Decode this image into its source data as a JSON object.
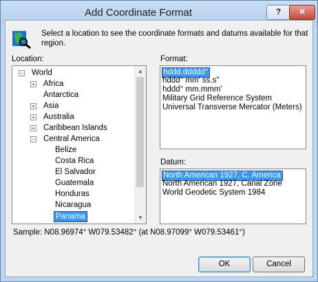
{
  "title": "Add Coordinate Format",
  "titlebar": {
    "help": "?",
    "close": "✕"
  },
  "intro_text": "Select a location to see the coordinate formats and datums available for that region.",
  "location_label": "Location:",
  "format_label": "Format:",
  "datum_label": "Datum:",
  "tree": [
    {
      "label": "World",
      "depth": 0,
      "expander": "−"
    },
    {
      "label": "Africa",
      "depth": 1,
      "expander": "+"
    },
    {
      "label": "Antarctica",
      "depth": 1,
      "expander": ""
    },
    {
      "label": "Asia",
      "depth": 1,
      "expander": "+"
    },
    {
      "label": "Australia",
      "depth": 1,
      "expander": "+"
    },
    {
      "label": "Caribbean Islands",
      "depth": 1,
      "expander": "+"
    },
    {
      "label": "Central America",
      "depth": 1,
      "expander": "−"
    },
    {
      "label": "Belize",
      "depth": 2,
      "expander": ""
    },
    {
      "label": "Costa Rica",
      "depth": 2,
      "expander": ""
    },
    {
      "label": "El Salvador",
      "depth": 2,
      "expander": ""
    },
    {
      "label": "Guatemala",
      "depth": 2,
      "expander": ""
    },
    {
      "label": "Honduras",
      "depth": 2,
      "expander": ""
    },
    {
      "label": "Nicaragua",
      "depth": 2,
      "expander": ""
    },
    {
      "label": "Panama",
      "depth": 2,
      "expander": "",
      "selected": true
    }
  ],
  "formats": [
    {
      "label": "hddd.ddddd°",
      "selected": true
    },
    {
      "label": "hddd° mm' ss.s\""
    },
    {
      "label": "hddd° mm.mmm'"
    },
    {
      "label": "Military Grid Reference System"
    },
    {
      "label": "Universal Transverse Mercator (Meters)"
    }
  ],
  "datums": [
    {
      "label": "North American 1927, C. America",
      "selected": true
    },
    {
      "label": "North American 1927, Canal Zone"
    },
    {
      "label": "World Geodetic System 1984"
    }
  ],
  "sample_text": "Sample: N08.96974°  W079.53482° (at N08.97099°  W079.53461°)",
  "ok_label": "OK",
  "cancel_label": "Cancel",
  "colors": {
    "selection": "#3399ff",
    "title_bar": "#bfd6ee",
    "close_button": "#c64a3a"
  }
}
